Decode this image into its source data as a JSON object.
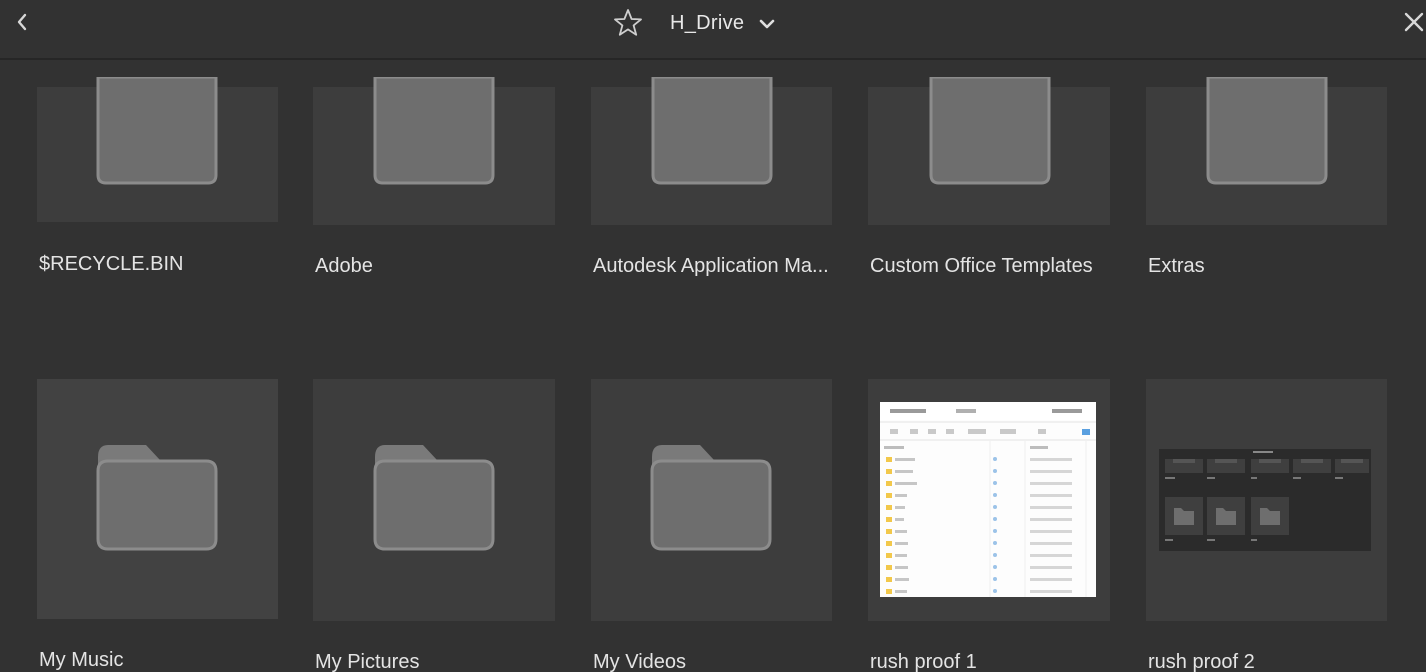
{
  "header": {
    "title": "H_Drive",
    "back_icon": "chevron-left-icon",
    "favorite_icon": "star-outline-icon",
    "dropdown_icon": "chevron-down-icon",
    "close_icon": "close-icon"
  },
  "folders_row1": [
    {
      "name": "$RECYCLE.BIN",
      "icon": "folder-icon"
    },
    {
      "name": "Adobe",
      "icon": "folder-icon"
    },
    {
      "name": "Autodesk Application Ma...",
      "icon": "folder-icon"
    },
    {
      "name": "Custom Office Templates",
      "icon": "folder-icon"
    },
    {
      "name": "Extras",
      "icon": "folder-icon"
    }
  ],
  "folders_row2": [
    {
      "name": "My Music",
      "icon": "folder-icon",
      "selected": true
    },
    {
      "name": "My Pictures",
      "icon": "folder-icon"
    },
    {
      "name": "My Videos",
      "icon": "folder-icon"
    },
    {
      "name": "rush proof 1",
      "icon": "image-thumbnail"
    },
    {
      "name": "rush proof 2",
      "icon": "image-thumbnail"
    }
  ],
  "colors": {
    "background": "#323232",
    "tile": "#3d3d3d",
    "folder_fill": "#6e6e6e",
    "folder_stroke": "#8a8a8a"
  }
}
